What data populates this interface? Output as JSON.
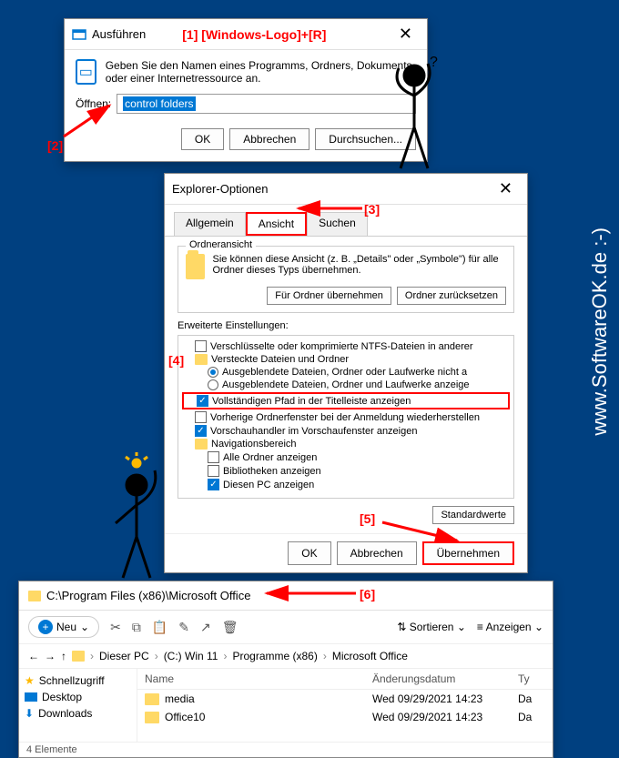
{
  "annotations": {
    "a1": "[1]",
    "a1_text": "[Windows-Logo]+[R]",
    "a2": "[2]",
    "a3": "[3]",
    "a4": "[4]",
    "a5": "[5]",
    "a6": "[6]"
  },
  "watermark": "www.SoftwareOK.de :-)",
  "run": {
    "title": "Ausführen",
    "desc": "Geben Sie den Namen eines Programms, Ordners, Dokuments oder einer Internetressource an.",
    "open_label": "Öffnen:",
    "value": "control folders",
    "ok": "OK",
    "cancel": "Abbrechen",
    "browse": "Durchsuchen..."
  },
  "opts": {
    "title": "Explorer-Optionen",
    "tabs": {
      "general": "Allgemein",
      "view": "Ansicht",
      "search": "Suchen"
    },
    "folderview_label": "Ordneransicht",
    "folderview_desc": "Sie können diese Ansicht (z. B. „Details\" oder „Symbole\") für alle Ordner dieses Typs übernehmen.",
    "apply_folders": "Für Ordner übernehmen",
    "reset_folders": "Ordner zurücksetzen",
    "advanced_label": "Erweiterte Einstellungen:",
    "items": {
      "i0": "Verschlüsselte oder komprimierte NTFS-Dateien in anderer",
      "i1": "Versteckte Dateien und Ordner",
      "i2": "Ausgeblendete Dateien, Ordner oder Laufwerke nicht a",
      "i3": "Ausgeblendete Dateien, Ordner und Laufwerke anzeige",
      "i4": "Vollständigen Pfad in der Titelleiste anzeigen",
      "i5": "Vorherige Ordnerfenster bei der Anmeldung wiederherstellen",
      "i6": "Vorschauhandler im Vorschaufenster anzeigen",
      "i7": "Navigationsbereich",
      "i8": "Alle Ordner anzeigen",
      "i9": "Bibliotheken anzeigen",
      "i10": "Diesen PC anzeigen"
    },
    "defaults": "Standardwerte",
    "ok": "OK",
    "cancel": "Abbrechen",
    "apply": "Übernehmen"
  },
  "explorer": {
    "title": "C:\\Program Files (x86)\\Microsoft Office",
    "new": "Neu",
    "sort": "Sortieren",
    "view": "Anzeigen",
    "crumbs": {
      "c0": "Dieser PC",
      "c1": "(C:) Win 11",
      "c2": "Programme (x86)",
      "c3": "Microsoft Office"
    },
    "side": {
      "quick": "Schnellzugriff",
      "desktop": "Desktop",
      "downloads": "Downloads"
    },
    "cols": {
      "name": "Name",
      "date": "Änderungsdatum",
      "type": "Ty"
    },
    "rows": {
      "r0": {
        "name": "media",
        "date": "Wed 09/29/2021 14:23",
        "type": "Da"
      },
      "r1": {
        "name": "Office10",
        "date": "Wed 09/29/2021 14:23",
        "type": "Da"
      }
    },
    "status": "4 Elemente"
  }
}
